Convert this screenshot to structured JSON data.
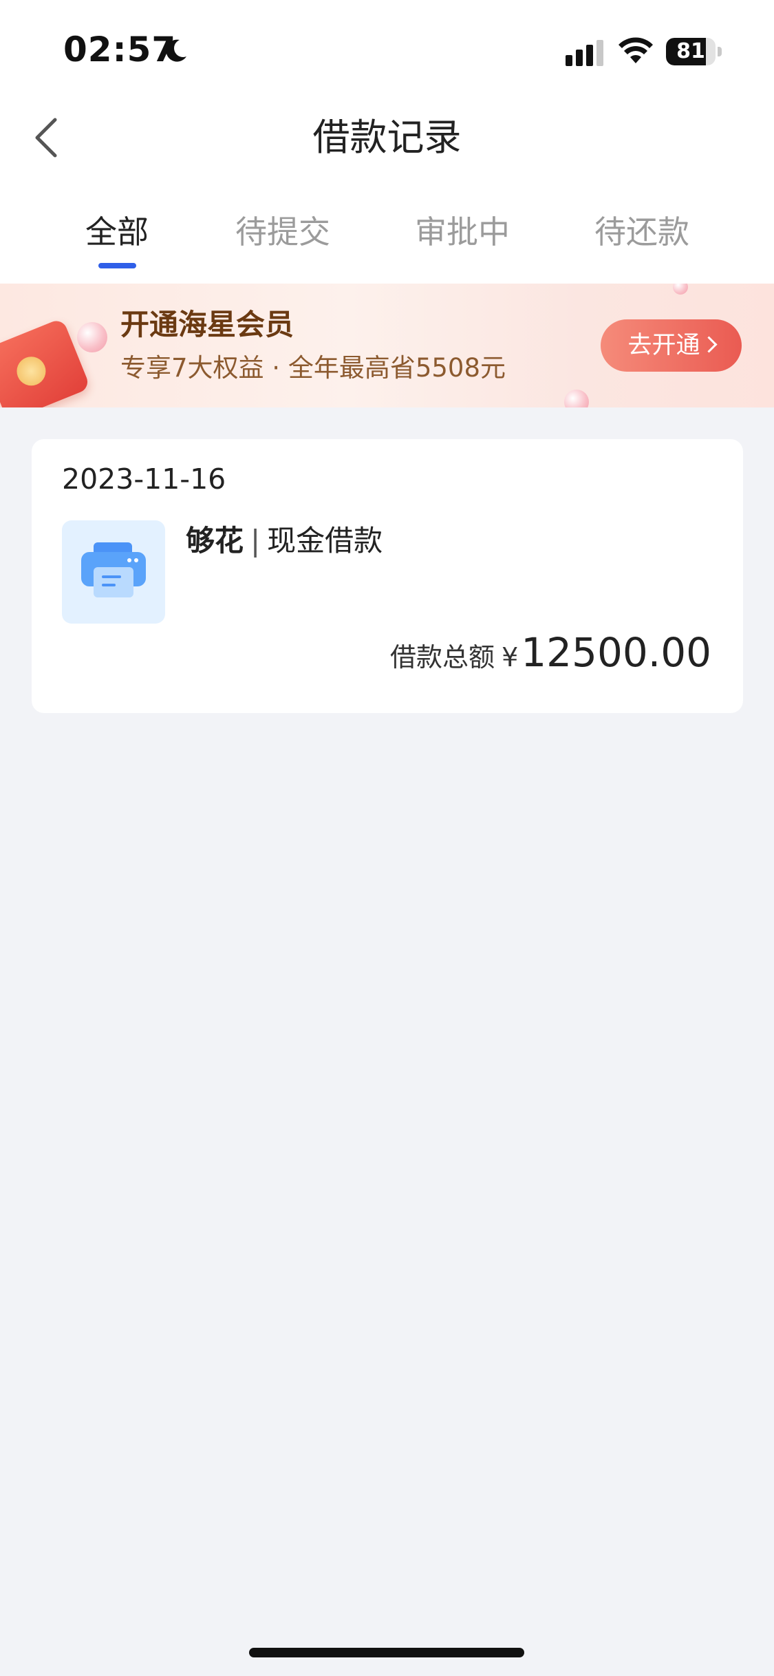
{
  "status_bar": {
    "time": "02:57",
    "battery": "81",
    "battery_level": 0.81
  },
  "header": {
    "title": "借款记录"
  },
  "tabs": [
    {
      "label": "全部",
      "active": true
    },
    {
      "label": "待提交",
      "active": false
    },
    {
      "label": "审批中",
      "active": false
    },
    {
      "label": "待还款",
      "active": false
    }
  ],
  "promo": {
    "title": "开通海星会员",
    "subtitle": "专享7大权益 · 全年最高省5508元",
    "button_label": "去开通"
  },
  "records": [
    {
      "date": "2023-11-16",
      "brand": "够花",
      "separator": "|",
      "type": "现金借款",
      "amount_label": "借款总额",
      "currency": "¥",
      "amount": "12500.00"
    }
  ],
  "colors": {
    "accent": "#2f5fe8",
    "background": "#f2f3f7",
    "promo_button": "#ea5b52"
  },
  "icons": {
    "back": "chevron-left-icon",
    "moon": "moon-icon",
    "signal": "signal-icon",
    "wifi": "wifi-icon",
    "product": "printer-icon"
  }
}
